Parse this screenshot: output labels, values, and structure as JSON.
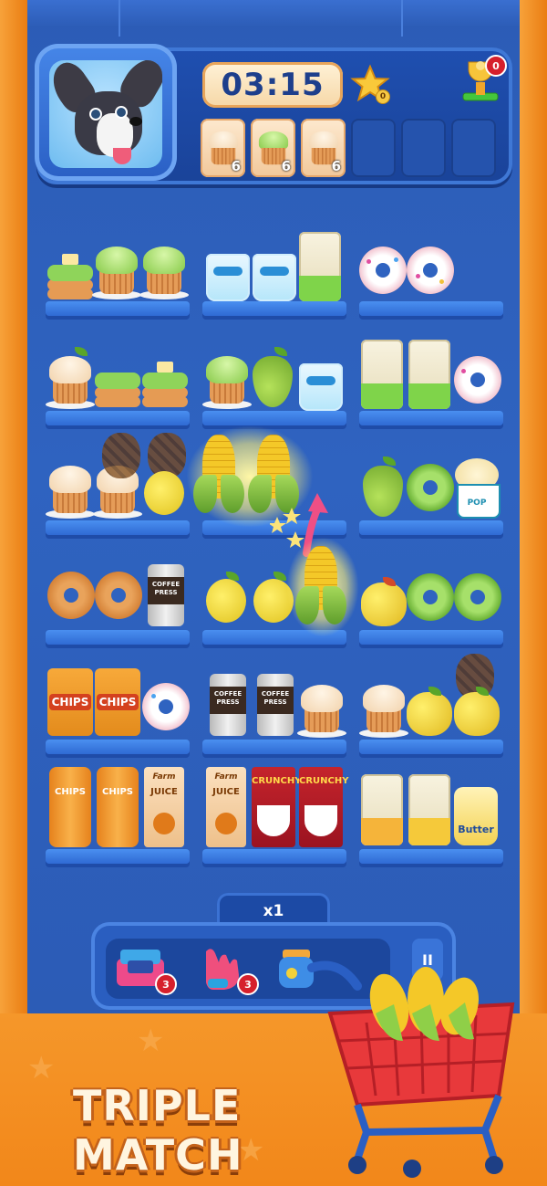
{
  "hud": {
    "timer": "03:15",
    "star_count": "0",
    "trophy_count": "0",
    "goals": [
      {
        "item": "vanilla-cupcake",
        "count": "6"
      },
      {
        "item": "green-cupcake",
        "count": "6"
      },
      {
        "item": "vanilla-cupcake",
        "count": "6"
      }
    ],
    "empty_slots": 3
  },
  "shelf_labels": {
    "coffee_can": "COFFEE PRESS",
    "chips_bag": "CHIPS",
    "chips_tube": "CHIPS",
    "juice_brand": "Farm",
    "juice": "JUICE",
    "cereal": "CRUNCHY",
    "butter": "Butter",
    "popcorn": "POP"
  },
  "multiplier": "x1",
  "tools": [
    {
      "name": "cart-box",
      "count": "3"
    },
    {
      "name": "glove",
      "count": "3"
    },
    {
      "name": "jar",
      "count": ""
    }
  ],
  "banner": {
    "line1": "TRIPLE",
    "line2": "MATCH"
  },
  "colors": {
    "board": "#2f63c0",
    "frame": "#f08a1e",
    "accent": "#f7c843"
  }
}
